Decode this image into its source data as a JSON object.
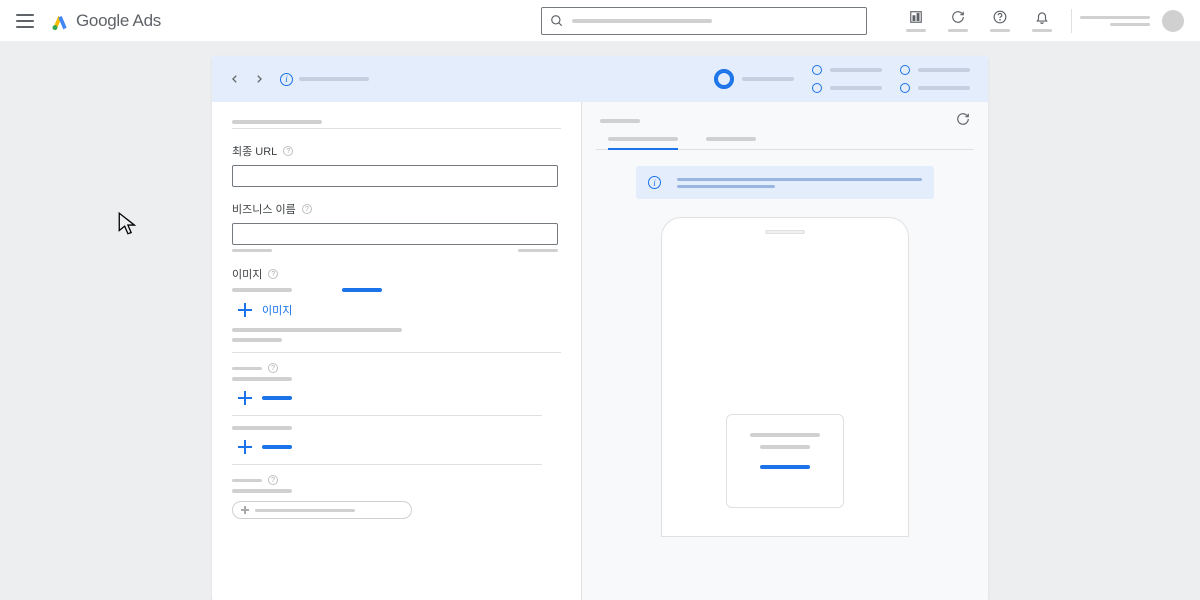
{
  "header": {
    "brand_google": "Google",
    "brand_ads": "Ads"
  },
  "form": {
    "final_url_label": "최종 URL",
    "business_name_label": "비즈니스 이름",
    "images_label": "이미지",
    "add_image_label": "이미지"
  }
}
